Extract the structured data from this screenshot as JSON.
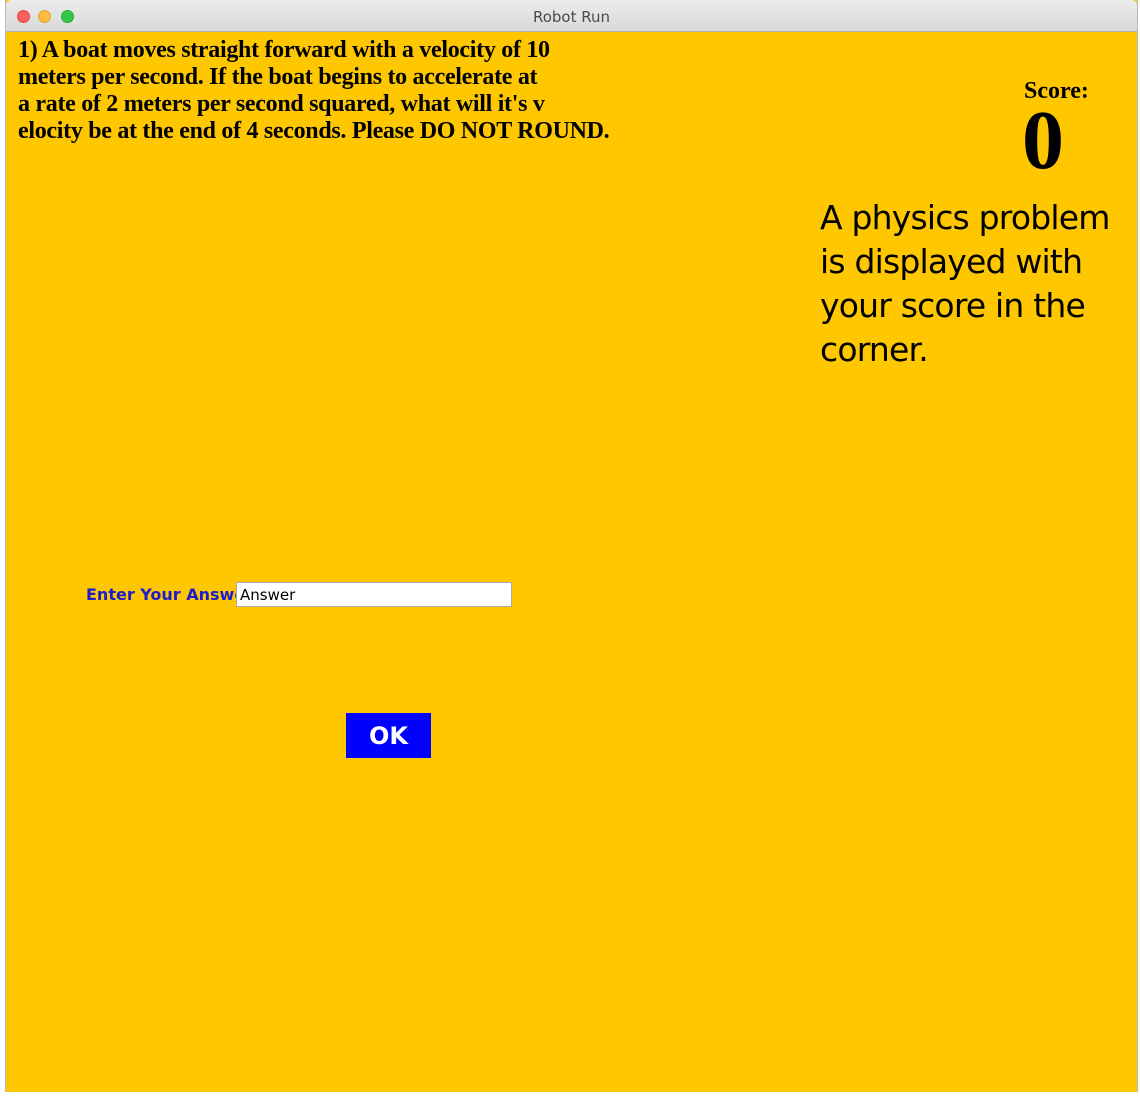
{
  "window": {
    "title": "Robot Run"
  },
  "question": {
    "lines": [
      "1) A boat moves straight forward with a velocity of 10",
      "meters per second. If the boat begins to accelerate at",
      "a rate of 2 meters per second squared, what will it's v",
      "elocity be at the end of 4 seconds. Please DO NOT ROUND."
    ]
  },
  "score": {
    "label": "Score:",
    "value": "0"
  },
  "caption": "A physics problem is displayed with your score in the corner.",
  "answer": {
    "label": "Enter Your Answer",
    "value": "Answer"
  },
  "ok_button": {
    "label": "OK"
  },
  "colors": {
    "background": "#fec700",
    "label_blue": "#1a1ad0",
    "button_blue": "#0000ff"
  }
}
